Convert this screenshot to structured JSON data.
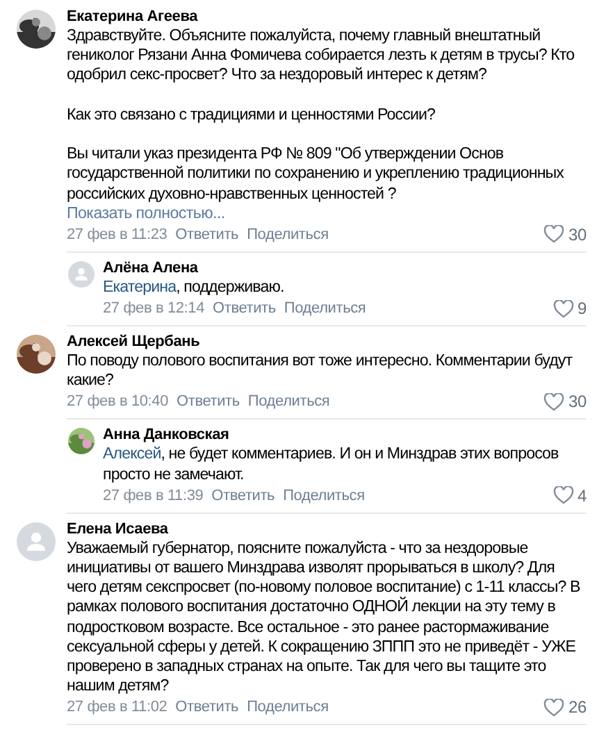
{
  "comments": [
    {
      "author": "Екатерина Агеева",
      "text": "Здравствуйте. Объясните пожалуйста, почему главный внештатный геникoлог Рязани Анна Фомичева собирается лезть к детям в трусы? Кто одобрил секс-просвет? Что за нездоровый интерес к детям?\n\nКак это связано с традициями и ценностями России?\n\nВы читали указ президента РФ № 809 \"Об утверждении Основ государственной политики по сохранению и укреплению традиционных российских духовно-нравственных ценностей ?",
      "show_more": "Показать полностью...",
      "date": "27 фев в 11:23",
      "reply": "Ответить",
      "share": "Поделиться",
      "likes": "30",
      "replies": [
        {
          "author": "Алёна Алена",
          "avatar": {
            "kind": "placeholder"
          },
          "addressee": "Екатерина",
          "text": ", поддерживаю.",
          "date": "27 фев в 12:14",
          "reply": "Ответить",
          "share": "Поделиться",
          "likes": "9"
        }
      ]
    },
    {
      "author": "Алексей Щербань",
      "text": "По поводу полового воспитания вот тоже интересно. Комментарии будут какие?",
      "date": "27 фев в 10:40",
      "reply": "Ответить",
      "share": "Поделиться",
      "likes": "30",
      "replies": [
        {
          "author": "Анна Данковская",
          "addressee": "Алексей",
          "text": ", не будет комментариев. И он и Минздрав этих вопросов просто не замечают.",
          "date": "27 фев в 11:39",
          "reply": "Ответить",
          "share": "Поделиться",
          "likes": "4"
        }
      ]
    },
    {
      "author": "Елена Исаева",
      "avatar": {
        "kind": "placeholder"
      },
      "text": "Уважаемый губернатор, поясните пожалуйста - что за нездоровые инициативы от вашего Минздрава изволят прорываться в школу? Для чего детям секспросвет (по-новому половое воспитание) с 1-11 классы? В рамках полового воспитания достаточно ОДНОЙ лекции на эту тему в подростковом возрасте. Все остальное - это ранее растормаживание сексуальной сферы у детей. К сокращению ЗППП это не приведёт - УЖЕ проверено в западных странах на опыте. Так для чего вы тащите это нашим детям?",
      "date": "27 фев в 11:02",
      "reply": "Ответить",
      "share": "Поделиться",
      "likes": "26"
    }
  ]
}
